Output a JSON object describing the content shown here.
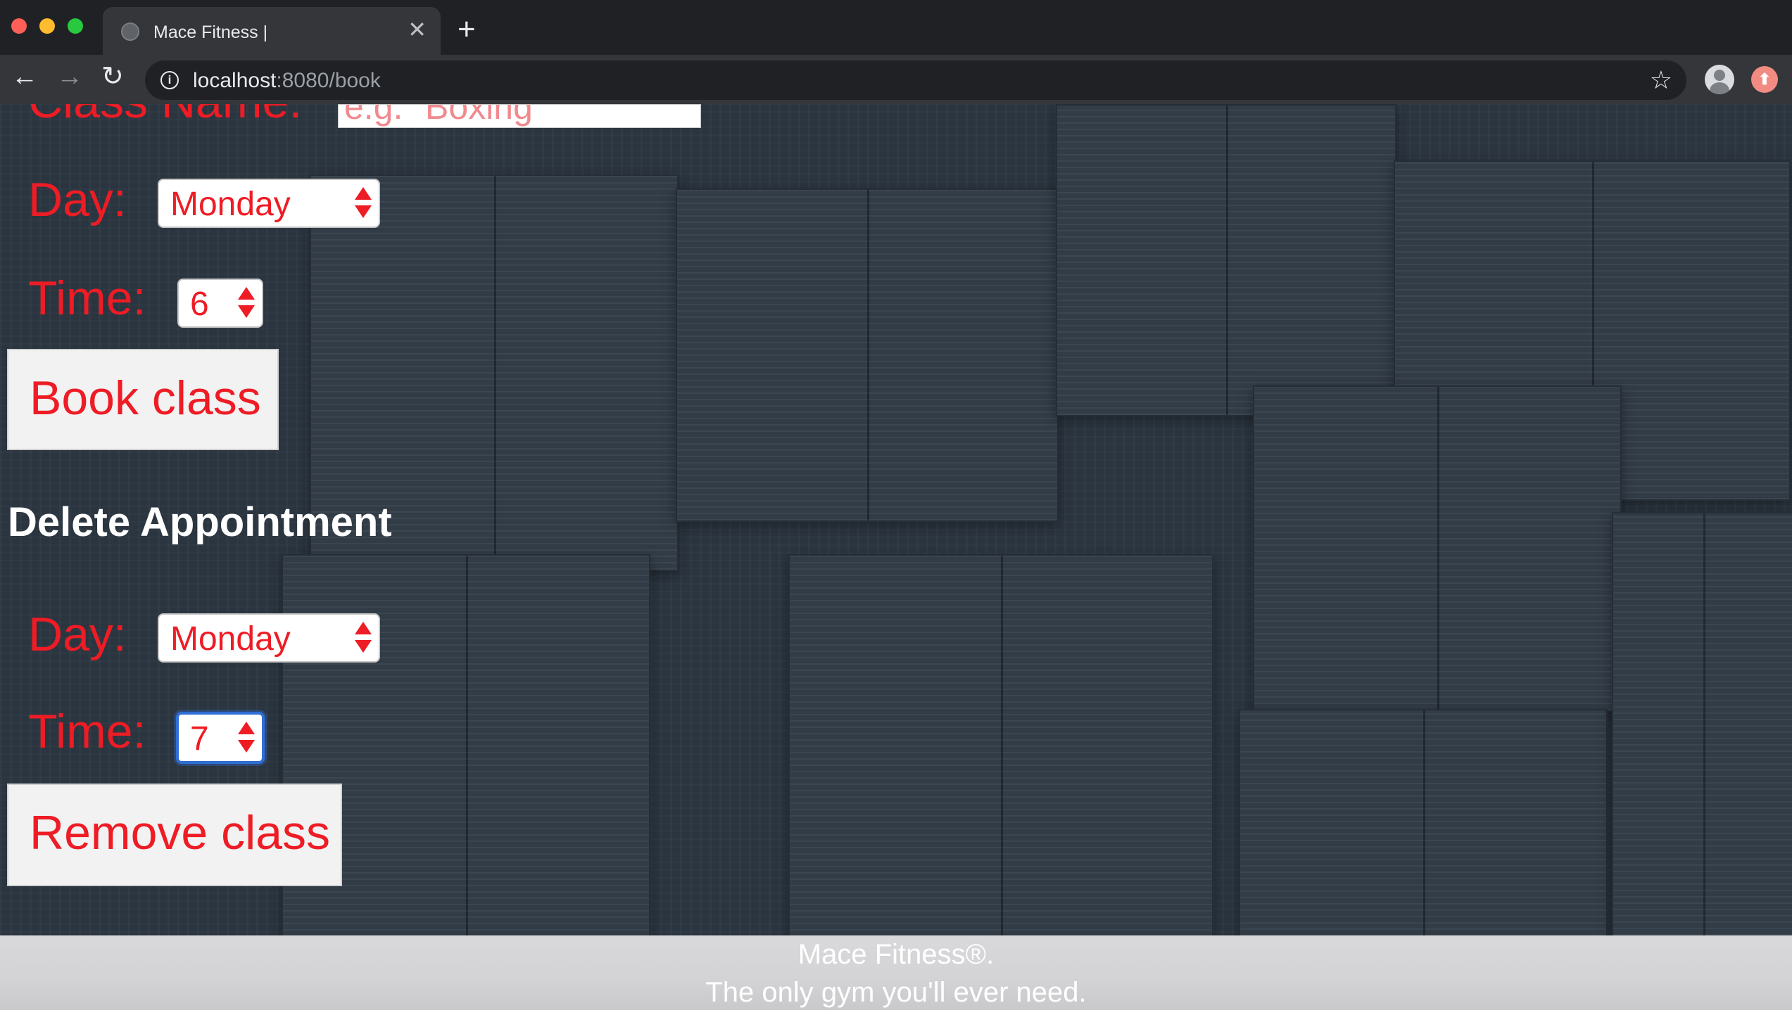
{
  "browser": {
    "tab_title": "Mace Fitness |",
    "tab_close": "✕",
    "new_tab": "+",
    "url_host": "localhost",
    "url_rest": ":8080/book",
    "back_icon": "←",
    "forward_icon": "→",
    "reload_icon": "↻",
    "info_icon": "i",
    "bookmark_icon": "☆"
  },
  "book_section": {
    "class_name_label": "Class Name:",
    "class_name_placeholder": "e.g. \"Boxing\"",
    "day_label": "Day:",
    "day_value": "Monday",
    "time_label": "Time:",
    "time_value": "6",
    "button_label": "Book class"
  },
  "delete_section": {
    "heading": "Delete Appointment",
    "day_label": "Day:",
    "day_value": "Monday",
    "time_label": "Time:",
    "time_value": "7",
    "button_label": "Remove class"
  },
  "footer": {
    "line1": "Mace Fitness®.",
    "line2": "The only gym you'll ever need."
  },
  "colors": {
    "accent_red": "#ee1c25",
    "focus_blue": "#2f6fd6",
    "footer_gray": "#d4d4d6"
  }
}
